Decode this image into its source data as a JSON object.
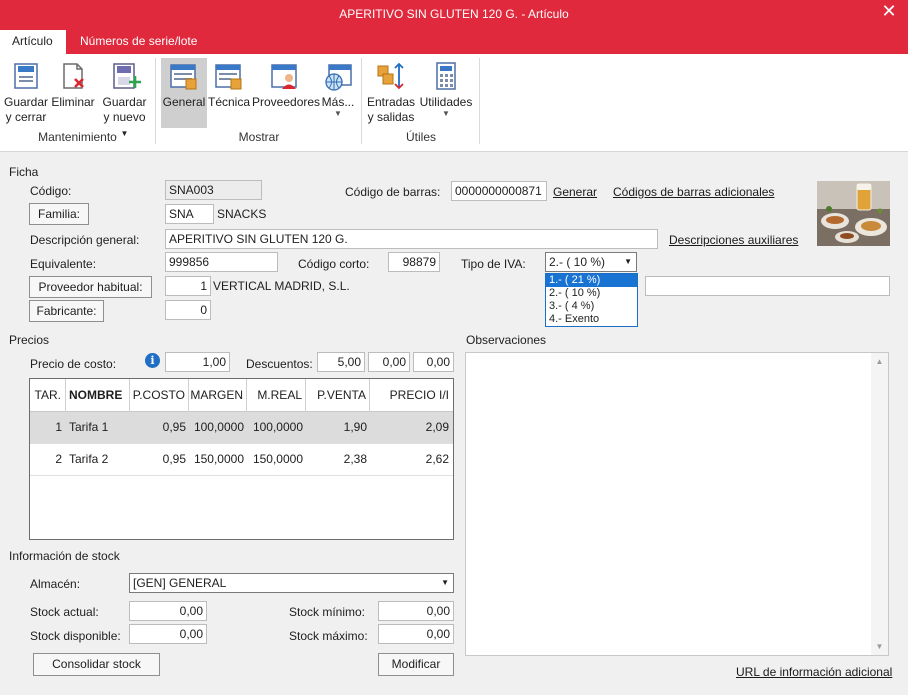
{
  "window": {
    "title": "APERITIVO SIN GLUTEN 120 G. - Artículo",
    "close": "✕"
  },
  "tabs": [
    "Artículo",
    "Números de serie/lote"
  ],
  "ribbon": {
    "mantenimiento": {
      "label": "Mantenimiento",
      "guardar_cerrar": [
        "Guardar",
        "y cerrar"
      ],
      "eliminar": "Eliminar",
      "guardar_nuevo": [
        "Guardar",
        "y nuevo"
      ]
    },
    "mostrar": {
      "label": "Mostrar",
      "general": "General",
      "tecnica": "Técnica",
      "proveedores": "Proveedores",
      "mas": "Más..."
    },
    "utiles": {
      "label": "Útiles",
      "entradas": [
        "Entradas",
        "y salidas"
      ],
      "utilidades": "Utilidades"
    }
  },
  "ficha": {
    "section": "Ficha",
    "codigo_label": "Código:",
    "codigo": "SNA003",
    "familia_button": "Familia:",
    "familia_code": "SNA",
    "familia_name": "SNACKS",
    "descripcion_label": "Descripción general:",
    "descripcion": "APERITIVO SIN GLUTEN 120 G.",
    "equivalente_label": "Equivalente:",
    "equivalente": "999856",
    "proveedor_button": "Proveedor habitual:",
    "proveedor_code": "1",
    "proveedor_name": "VERTICAL MADRID, S.L.",
    "fabricante_button": "Fabricante:",
    "fabricante_code": "0",
    "codigo_barras_label": "Código de barras:",
    "codigo_barras": "0000000000871",
    "generar_link": "Generar",
    "codigos_adicionales_link": "Códigos de barras adicionales",
    "descripciones_auxiliares_link": "Descripciones auxiliares",
    "codigo_corto_label": "Código corto:",
    "codigo_corto": "98879",
    "iva_label": "Tipo de IVA:",
    "iva_selected": "2.- ( 10 %)",
    "iva_options": [
      "1.- ( 21 %)",
      "2.- ( 10 %)",
      "3.- ( 4 %)",
      "4.- Exento"
    ],
    "iva_highlighted": 0
  },
  "precios": {
    "section": "Precios",
    "precio_costo_label": "Precio de costo:",
    "precio_costo": "1,00",
    "descuentos_label": "Descuentos:",
    "descuentos": [
      "5,00",
      "0,00",
      "0,00"
    ],
    "columns": [
      "TAR.",
      "NOMBRE",
      "P.COSTO",
      "MARGEN",
      "M.REAL",
      "P.VENTA",
      "PRECIO I/I"
    ],
    "rows": [
      [
        "1",
        "Tarifa 1",
        "0,95",
        "100,0000",
        "100,0000",
        "1,90",
        "2,09"
      ],
      [
        "2",
        "Tarifa 2",
        "0,95",
        "150,0000",
        "150,0000",
        "2,38",
        "2,62"
      ]
    ]
  },
  "observaciones": {
    "section": "Observaciones",
    "text": ""
  },
  "stock": {
    "section": "Información de stock",
    "almacen_label": "Almacén:",
    "almacen": "[GEN] GENERAL",
    "stock_actual_label": "Stock actual:",
    "stock_actual": "0,00",
    "stock_disponible_label": "Stock disponible:",
    "stock_disponible": "0,00",
    "stock_minimo_label": "Stock mínimo:",
    "stock_minimo": "0,00",
    "stock_maximo_label": "Stock máximo:",
    "stock_maximo": "0,00",
    "consolidar_button": "Consolidar stock",
    "modificar_button": "Modificar"
  },
  "url_link": "URL de información adicional",
  "colors": {
    "accent": "#e0293d",
    "selection": "#1873d3",
    "info": "#1f6fc5"
  }
}
